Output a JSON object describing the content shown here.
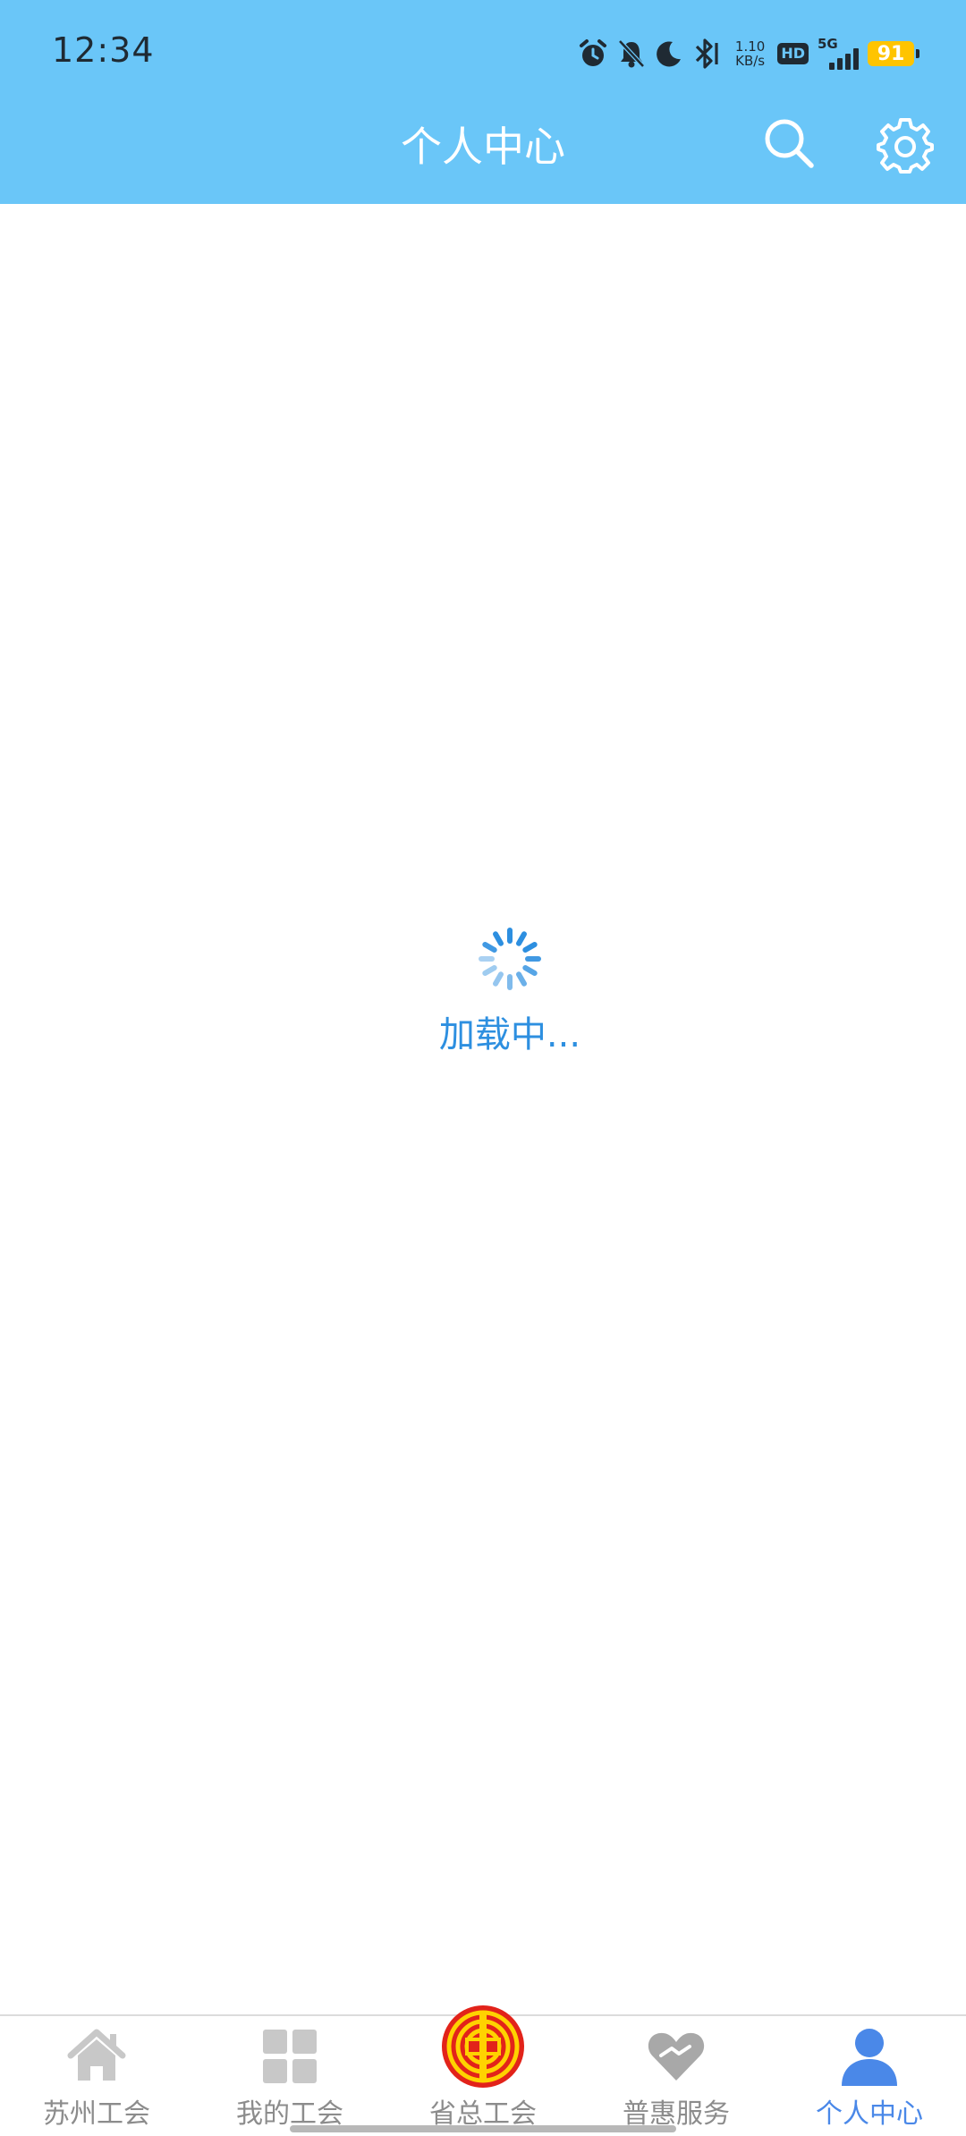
{
  "status_bar": {
    "time": "12:34",
    "net_speed_value": "1.10",
    "net_speed_unit": "KB/s",
    "hd_label": "HD",
    "network_label": "5G",
    "battery_level": "91",
    "icons": [
      "alarm-icon",
      "mute-bell-icon",
      "moon-icon",
      "bluetooth-icon",
      "signal-icon",
      "battery-icon"
    ]
  },
  "header": {
    "title": "个人中心",
    "search_icon": "search-icon",
    "settings_icon": "gear-icon"
  },
  "loading": {
    "text": "加载中..."
  },
  "tabbar": {
    "items": [
      {
        "label": "苏州工会",
        "icon": "home-icon",
        "active": false
      },
      {
        "label": "我的工会",
        "icon": "grid-icon",
        "active": false
      },
      {
        "label": "省总工会",
        "icon": "union-emblem-icon",
        "active": false
      },
      {
        "label": "普惠服务",
        "icon": "heart-icon",
        "active": false
      },
      {
        "label": "个人中心",
        "icon": "user-icon",
        "active": true
      }
    ]
  },
  "colors": {
    "header_bg": "#6ac6f8",
    "accent": "#4a88e8",
    "loading_text": "#2d8fe0",
    "tab_inactive": "#8c8c8c",
    "emblem_red": "#e2231a",
    "emblem_yellow": "#ffd200"
  }
}
